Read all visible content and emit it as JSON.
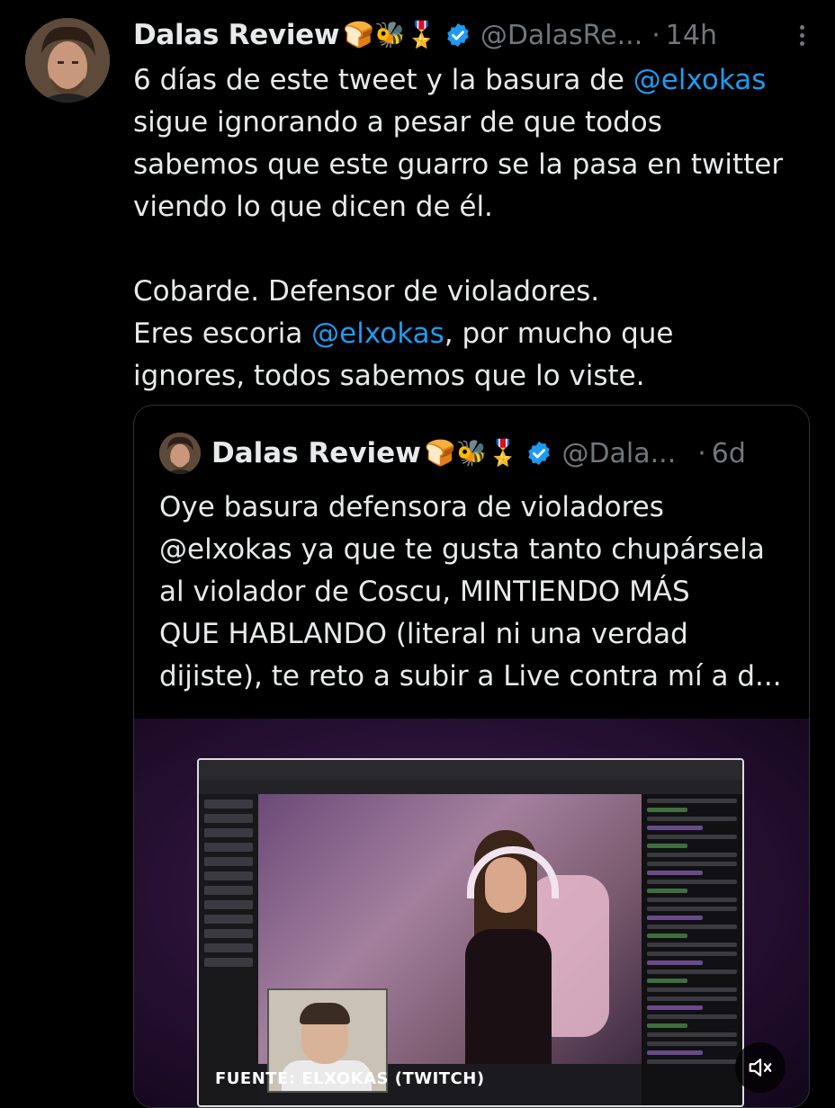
{
  "tweet": {
    "display_name": "Dalas Review",
    "name_emojis": "🍞🐝🎖️",
    "handle": "@DalasRe...",
    "separator": "·",
    "time": "14h",
    "lines": [
      [
        {
          "t": "6 días de este tweet y la basura de "
        },
        {
          "t": "@elxokas",
          "m": true
        }
      ],
      [
        {
          "t": "sigue ignorando a pesar de que todos"
        }
      ],
      [
        {
          "t": "sabemos que este guarro se la pasa en twitter"
        }
      ],
      [
        {
          "t": "viendo lo que dicen de él."
        }
      ],
      [],
      [
        {
          "t": "Cobarde. Defensor de violadores."
        }
      ],
      [
        {
          "t": "Eres escoria "
        },
        {
          "t": "@elxokas",
          "m": true
        },
        {
          "t": ", por mucho que"
        }
      ],
      [
        {
          "t": "ignores, todos sabemos que lo viste."
        }
      ]
    ]
  },
  "quoted": {
    "display_name": "Dalas Review",
    "name_emojis": "🍞🐝🎖️",
    "handle": "@Dala...",
    "separator": "·",
    "time": "6d",
    "lines": [
      "Oye basura defensora de violadores",
      "@elxokas ya que te gusta tanto chupársela",
      "al violador de Coscu, MINTIENDO MÁS",
      "QUE HABLANDO (literal ni una verdad",
      "dijiste), te reto a subir a Live contra mí a d..."
    ],
    "media": {
      "caption": "FUENTE: ELXOKAS (TWITCH)"
    }
  },
  "colors": {
    "background": "#000000",
    "text": "#e7e9ea",
    "muted": "#71767b",
    "link": "#1d9bf0",
    "verified": "#1d9bf0",
    "border": "#2f3336"
  },
  "icons": {
    "verified": "verified-badge-icon",
    "more": "more-options-icon",
    "mute": "muted-speaker-icon"
  }
}
